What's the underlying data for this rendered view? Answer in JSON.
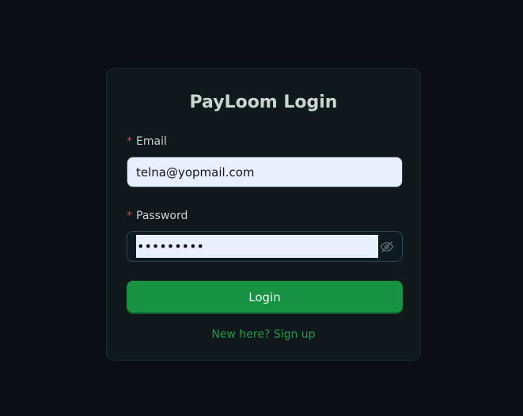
{
  "login": {
    "title": "PayLoom Login",
    "email": {
      "required_mark": "*",
      "label": "Email",
      "value": "telna@yopmail.com"
    },
    "password": {
      "required_mark": "*",
      "label": "Password",
      "value": "•••••••••",
      "toggle_icon": "eye-off-icon"
    },
    "submit_label": "Login",
    "signup_link": "New here? Sign up"
  },
  "colors": {
    "background": "#0b0f13",
    "card": "#0f181b",
    "accent": "#179242",
    "link": "#1e9a48",
    "required": "#e0443c",
    "input_fill": "#e8f0fe"
  }
}
